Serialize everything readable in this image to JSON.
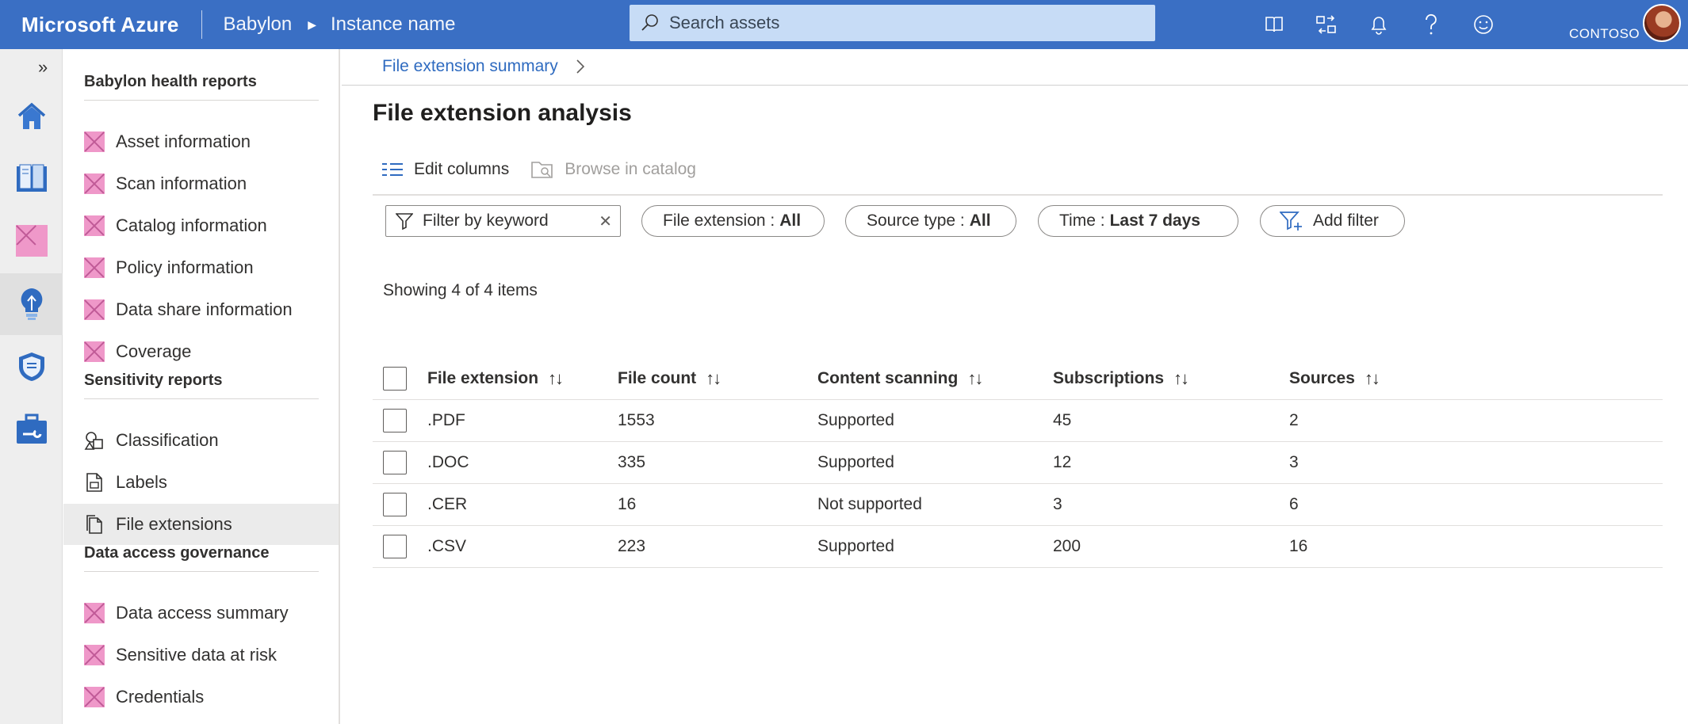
{
  "header": {
    "brand": "Microsoft Azure",
    "service": "Babylon",
    "instance": "Instance name",
    "search_placeholder": "Search assets",
    "tenant": "CONTOSO",
    "icons": [
      "book-icon",
      "switch-icon",
      "bell-icon",
      "help-icon",
      "smiley-icon"
    ]
  },
  "rail": {
    "items": [
      "home-icon",
      "catalog-icon",
      "placeholder-icon",
      "insights-icon",
      "policy-icon",
      "management-icon"
    ],
    "active_index": 3
  },
  "sidenav": {
    "sections": [
      {
        "title": "Babylon health reports",
        "items": [
          "Asset information",
          "Scan information",
          "Catalog information",
          "Policy information",
          "Data share information",
          "Coverage"
        ]
      },
      {
        "title": "Sensitivity reports",
        "items": [
          "Classification",
          "Labels",
          "File extensions"
        ]
      },
      {
        "title": "Data access governance",
        "items": [
          "Data access summary",
          "Sensitive data at risk",
          "Credentials"
        ]
      }
    ],
    "selected": "File extensions"
  },
  "breadcrumb": {
    "label": "File extension summary"
  },
  "page": {
    "title": "File extension analysis"
  },
  "toolbar": {
    "edit_columns": "Edit columns",
    "browse_catalog": "Browse in catalog"
  },
  "filters": {
    "keyword_placeholder": "Filter by keyword",
    "file_extension": {
      "label": "File extension : ",
      "value": "All"
    },
    "source_type": {
      "label": "Source type : ",
      "value": "All"
    },
    "time": {
      "label": "Time : ",
      "value": "Last 7 days"
    },
    "add_filter": "Add filter"
  },
  "summary": "Showing 4 of 4 items",
  "table": {
    "columns": [
      "File extension",
      "File count",
      "Content scanning",
      "Subscriptions",
      "Sources"
    ],
    "rows": [
      [
        ".PDF",
        "1553",
        "Supported",
        "45",
        "2"
      ],
      [
        ".DOC",
        "335",
        "Supported",
        "12",
        "3"
      ],
      [
        ".CER",
        "16",
        "Not supported",
        "3",
        "6"
      ],
      [
        ".CSV",
        "223",
        "Supported",
        "200",
        "16"
      ]
    ]
  },
  "colors": {
    "topbar": "#3a6fc4",
    "accent": "#2f6bc0",
    "placeholder_icon": "#ef98c9"
  }
}
